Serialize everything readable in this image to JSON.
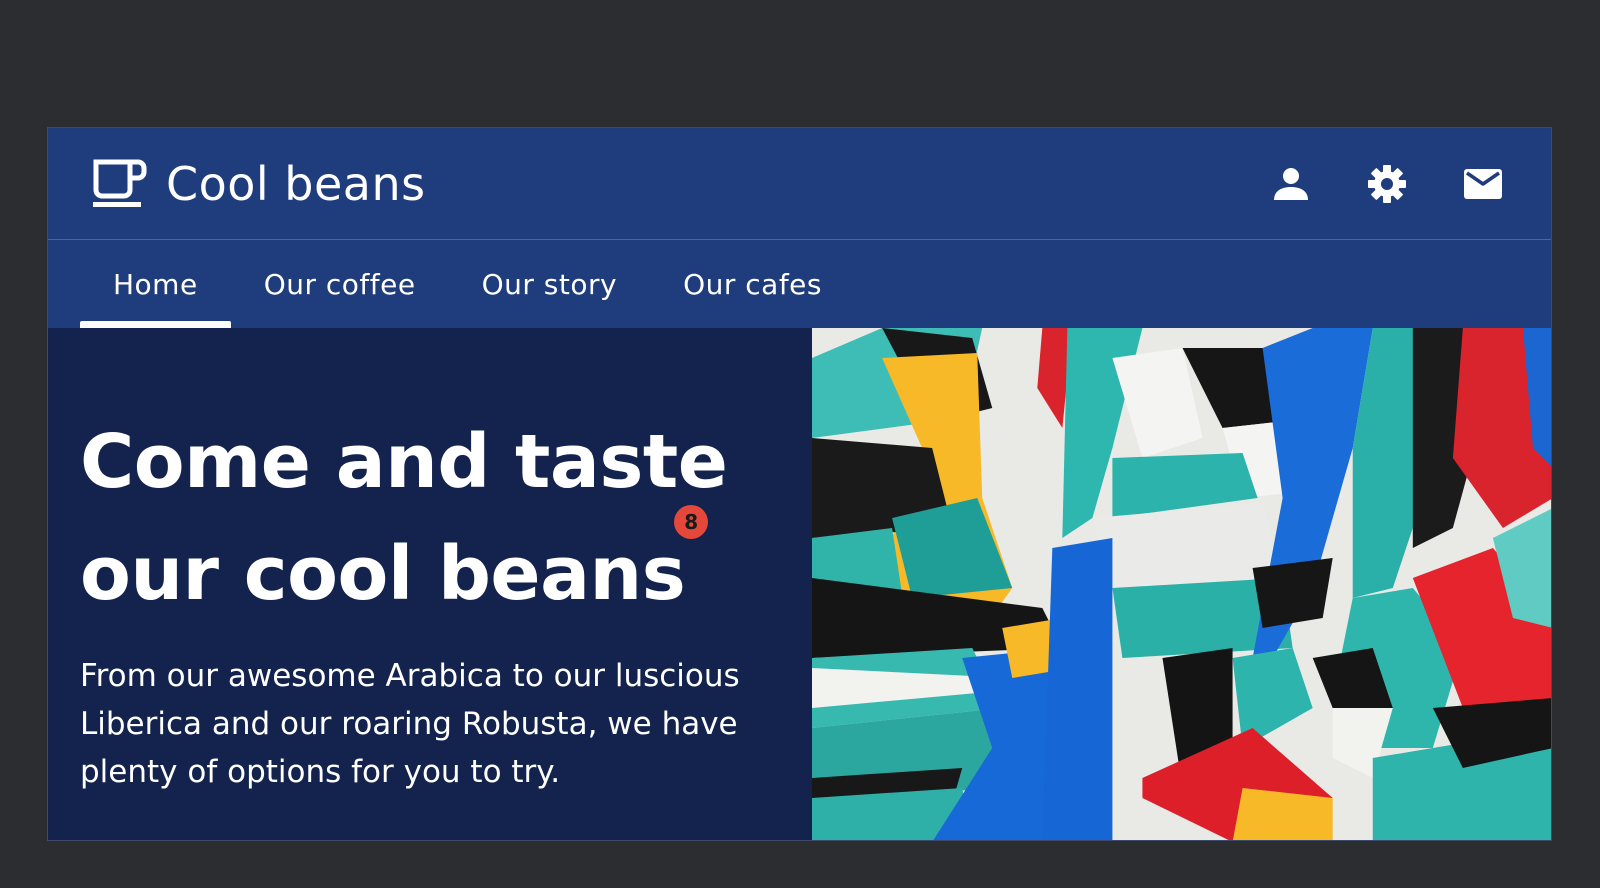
{
  "app": {
    "title": "Cool beans",
    "brand_icon": "coffee-cup-icon"
  },
  "header": {
    "actions": [
      {
        "name": "account",
        "icon": "person-icon"
      },
      {
        "name": "settings",
        "icon": "gear-icon"
      },
      {
        "name": "messages",
        "icon": "mail-icon"
      }
    ]
  },
  "nav": {
    "tabs": [
      {
        "label": "Home",
        "active": true
      },
      {
        "label": "Our coffee",
        "active": false
      },
      {
        "label": "Our story",
        "active": false
      },
      {
        "label": "Our cafes",
        "active": false
      }
    ]
  },
  "hero": {
    "headline_line1": "Come and taste",
    "headline_line2": "our cool beans",
    "badge_count": "8",
    "description": "From our awesome Arabica to our luscious Liberica and our roaring Robusta, we have plenty of options for you to try."
  },
  "colors": {
    "background": "#2b2d31",
    "header": "#1f3c7d",
    "hero": "#13234d",
    "badge": "#e5483b",
    "text": "#ffffff"
  }
}
